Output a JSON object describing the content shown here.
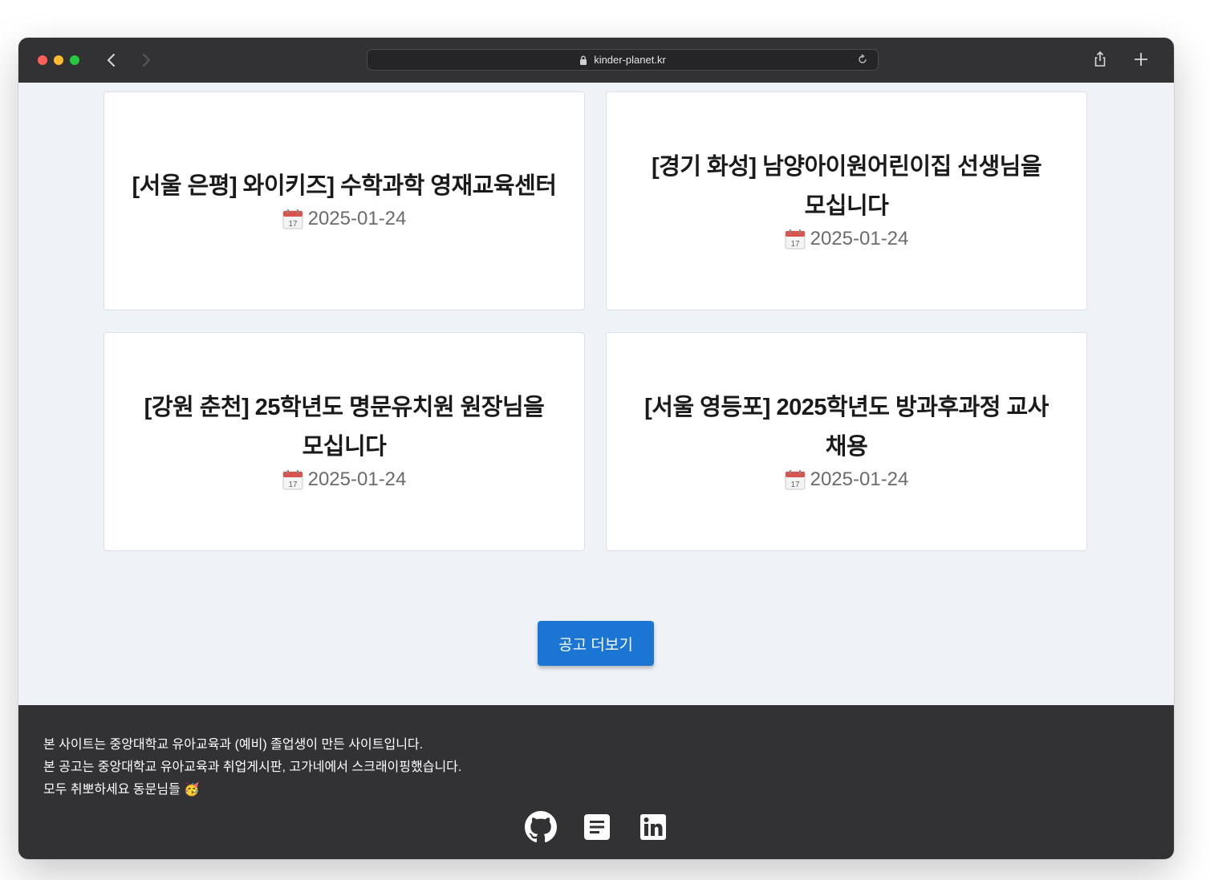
{
  "browser": {
    "url": "kinder-planet.kr",
    "icons": [
      "back-icon",
      "forward-icon",
      "lock-icon",
      "reload-icon",
      "share-icon",
      "plus-icon"
    ]
  },
  "cards": [
    {
      "title_line1": "[서울 은평] 와이키즈] 수학과학 영재교육센터",
      "title_line2": "",
      "date": "2025-01-24"
    },
    {
      "title_line1": "[경기 화성] 남양아이원어린이집 선생님을",
      "title_line2": "모십니다",
      "date": "2025-01-24"
    },
    {
      "title_line1": "[강원 춘천] 25학년도 명문유치원 원장님을",
      "title_line2": "모십니다",
      "date": "2025-01-24"
    },
    {
      "title_line1": "[서울 영등포] 2025학년도 방과후과정 교사",
      "title_line2": "채용",
      "date": "2025-01-24"
    }
  ],
  "more_button_label": "공고 더보기",
  "footer": {
    "line1": "본 사이트는 중앙대학교 유아교육과 (예비) 졸업생이 만든 사이트입니다.",
    "line2": "본 공고는 중앙대학교 유아교육과 취업게시판, 고가네에서 스크래이핑했습니다.",
    "line3": "모두 취뽀하세요 동문님들 🥳",
    "icons": [
      "github-icon",
      "blog-icon",
      "linkedin-icon"
    ]
  },
  "colors": {
    "titlebar": "#323235",
    "page_bg": "#eff3f8",
    "button_primary": "#1a76d2",
    "footer_bg": "#323235"
  }
}
